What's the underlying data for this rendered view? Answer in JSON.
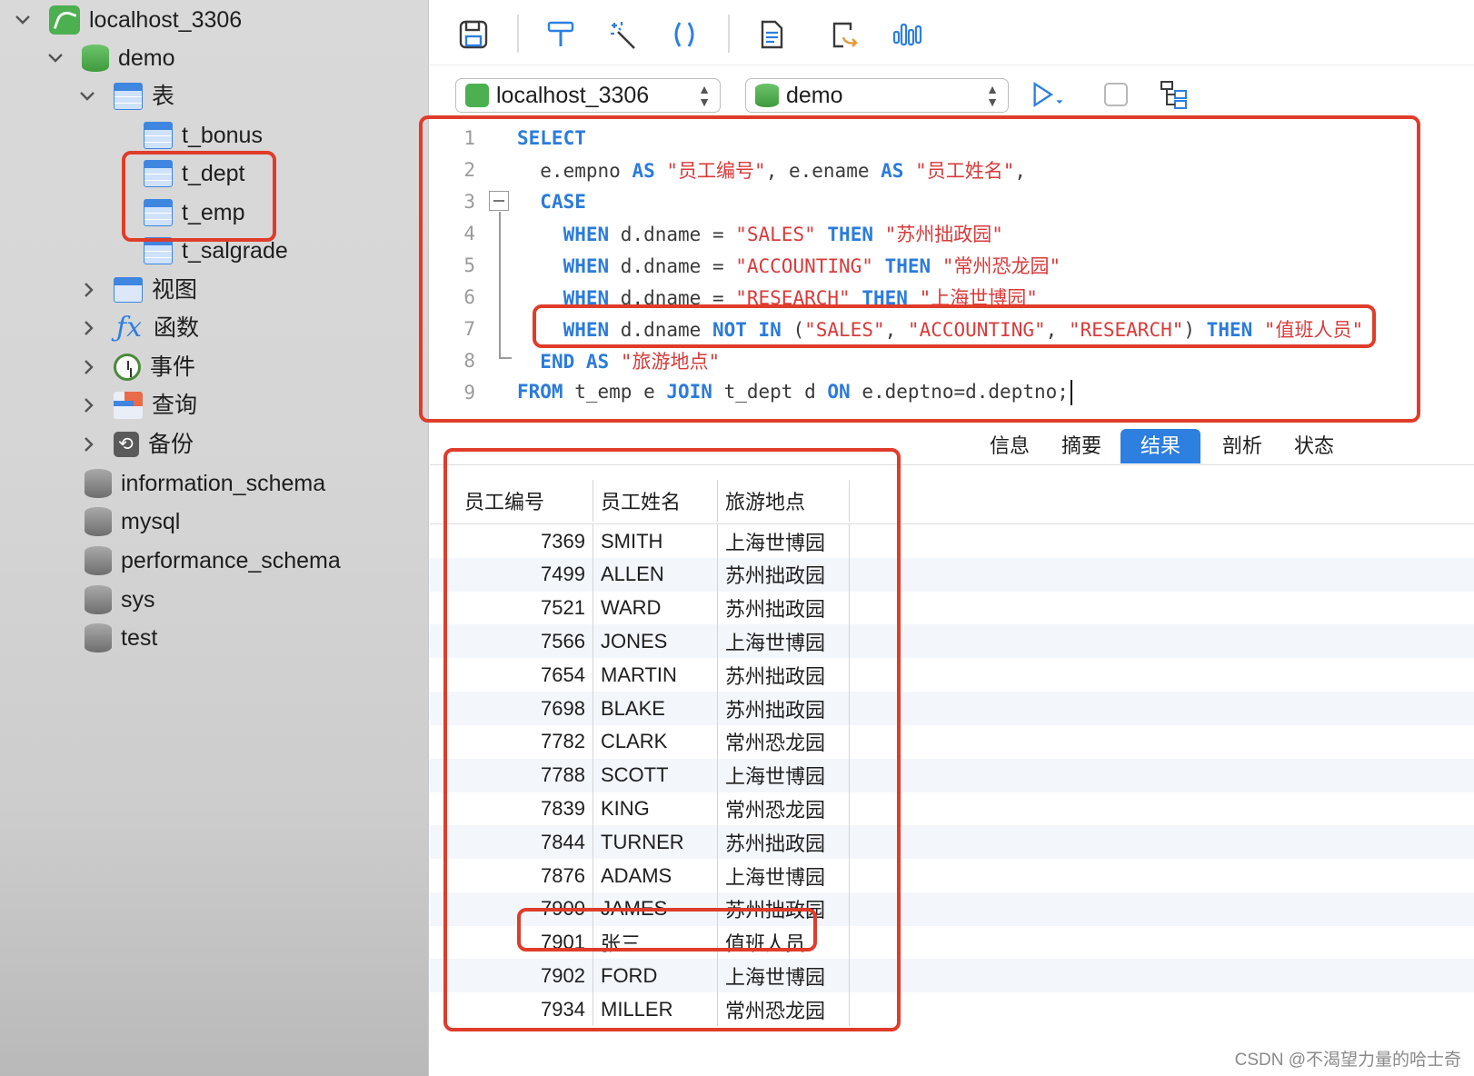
{
  "sidebar": {
    "connection": "localhost_3306",
    "database": "demo",
    "tables_group": "表",
    "tables": [
      "t_bonus",
      "t_dept",
      "t_emp",
      "t_salgrade"
    ],
    "groups": [
      "视图",
      "函数",
      "事件",
      "查询",
      "备份"
    ],
    "other_databases": [
      "information_schema",
      "mysql",
      "performance_schema",
      "sys",
      "test"
    ]
  },
  "toolbar": {
    "icons": [
      "save-icon",
      "format-icon",
      "magic-wand-icon",
      "code-snippet-icon",
      "text-file-icon",
      "export-icon",
      "explain-chart-icon"
    ]
  },
  "connbar": {
    "connection_select": "localhost_3306",
    "database_select": "demo"
  },
  "editor": {
    "lines": [
      {
        "n": "1",
        "tokens": [
          [
            "kw",
            "SELECT"
          ]
        ]
      },
      {
        "n": "2",
        "tokens": [
          [
            "id",
            "  e.empno "
          ],
          [
            "kw",
            "AS"
          ],
          [
            "id",
            " "
          ],
          [
            "str",
            "\"员工编号\""
          ],
          [
            "id",
            ", e.ename "
          ],
          [
            "kw",
            "AS"
          ],
          [
            "id",
            " "
          ],
          [
            "str",
            "\"员工姓名\""
          ],
          [
            "id",
            ","
          ]
        ]
      },
      {
        "n": "3",
        "tokens": [
          [
            "id",
            "  "
          ],
          [
            "kw",
            "CASE"
          ]
        ]
      },
      {
        "n": "4",
        "tokens": [
          [
            "id",
            "    "
          ],
          [
            "kw",
            "WHEN"
          ],
          [
            "id",
            " d.dname = "
          ],
          [
            "str",
            "\"SALES\""
          ],
          [
            "id",
            " "
          ],
          [
            "kw",
            "THEN"
          ],
          [
            "id",
            " "
          ],
          [
            "str",
            "\"苏州拙政园\""
          ]
        ]
      },
      {
        "n": "5",
        "tokens": [
          [
            "id",
            "    "
          ],
          [
            "kw",
            "WHEN"
          ],
          [
            "id",
            " d.dname = "
          ],
          [
            "str",
            "\"ACCOUNTING\""
          ],
          [
            "id",
            " "
          ],
          [
            "kw",
            "THEN"
          ],
          [
            "id",
            " "
          ],
          [
            "str",
            "\"常州恐龙园\""
          ]
        ]
      },
      {
        "n": "6",
        "tokens": [
          [
            "id",
            "    "
          ],
          [
            "kw",
            "WHEN"
          ],
          [
            "id",
            " d.dname = "
          ],
          [
            "str",
            "\"RESEARCH\""
          ],
          [
            "id",
            " "
          ],
          [
            "kw",
            "THEN"
          ],
          [
            "id",
            " "
          ],
          [
            "str",
            "\"上海世博园\""
          ]
        ]
      },
      {
        "n": "7",
        "tokens": [
          [
            "id",
            "    "
          ],
          [
            "kw",
            "WHEN"
          ],
          [
            "id",
            " d.dname "
          ],
          [
            "kw",
            "NOT IN"
          ],
          [
            "id",
            " ("
          ],
          [
            "str",
            "\"SALES\""
          ],
          [
            "id",
            ", "
          ],
          [
            "str",
            "\"ACCOUNTING\""
          ],
          [
            "id",
            ", "
          ],
          [
            "str",
            "\"RESEARCH\""
          ],
          [
            "id",
            ") "
          ],
          [
            "kw",
            "THEN"
          ],
          [
            "id",
            " "
          ],
          [
            "str",
            "\"值班人员\""
          ]
        ]
      },
      {
        "n": "8",
        "tokens": [
          [
            "id",
            "  "
          ],
          [
            "kw",
            "END AS"
          ],
          [
            "id",
            " "
          ],
          [
            "str",
            "\"旅游地点\""
          ]
        ]
      },
      {
        "n": "9",
        "tokens": [
          [
            "kw",
            "FROM"
          ],
          [
            "id",
            " t_emp e "
          ],
          [
            "kw",
            "JOIN"
          ],
          [
            "id",
            " t_dept d "
          ],
          [
            "kw",
            "ON"
          ],
          [
            "id",
            " e.deptno=d.deptno;"
          ]
        ]
      }
    ]
  },
  "result_tabs": [
    "信息",
    "摘要",
    "结果 1",
    "剖析",
    "状态"
  ],
  "active_tab": "结果 1",
  "grid": {
    "columns": [
      "员工编号",
      "员工姓名",
      "旅游地点"
    ],
    "rows": [
      [
        "7369",
        "SMITH",
        "上海世博园"
      ],
      [
        "7499",
        "ALLEN",
        "苏州拙政园"
      ],
      [
        "7521",
        "WARD",
        "苏州拙政园"
      ],
      [
        "7566",
        "JONES",
        "上海世博园"
      ],
      [
        "7654",
        "MARTIN",
        "苏州拙政园"
      ],
      [
        "7698",
        "BLAKE",
        "苏州拙政园"
      ],
      [
        "7782",
        "CLARK",
        "常州恐龙园"
      ],
      [
        "7788",
        "SCOTT",
        "上海世博园"
      ],
      [
        "7839",
        "KING",
        "常州恐龙园"
      ],
      [
        "7844",
        "TURNER",
        "苏州拙政园"
      ],
      [
        "7876",
        "ADAMS",
        "上海世博园"
      ],
      [
        "7900",
        "JAMES",
        "苏州拙政园"
      ],
      [
        "7901",
        "张三",
        "值班人员"
      ],
      [
        "7902",
        "FORD",
        "上海世博园"
      ],
      [
        "7934",
        "MILLER",
        "常州恐龙园"
      ]
    ]
  },
  "watermark": "CSDN @不渴望力量的哈士奇",
  "colors": {
    "keyword": "#2b7bdc",
    "string": "#d93a3a",
    "highlight": "#e03c2a",
    "accent": "#2d7fe0"
  }
}
